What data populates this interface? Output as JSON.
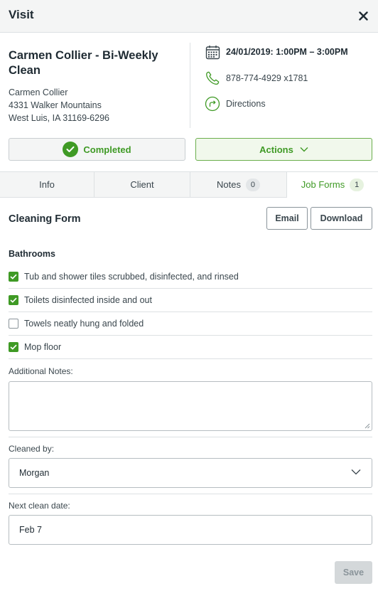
{
  "header": {
    "title": "Visit",
    "close_icon": "close-icon"
  },
  "client": {
    "title": "Carmen Collier - Bi-Weekly Clean",
    "name": "Carmen Collier",
    "street": "4331 Walker Mountains",
    "city": "West Luis, IA 31169-6296"
  },
  "details": {
    "date": "24/01/2019: 1:00PM – 3:00PM",
    "phone": "878-774-4929 x1781",
    "directions": "Directions",
    "date_icon": "calendar-icon",
    "phone_icon": "phone-icon",
    "directions_icon": "directions-icon"
  },
  "status": {
    "label": "Completed",
    "color": "#3f9a25"
  },
  "actions": {
    "label": "Actions"
  },
  "tabs": [
    {
      "label": "Info"
    },
    {
      "label": "Client"
    },
    {
      "label": "Notes",
      "badge": "0"
    },
    {
      "label": "Job Forms",
      "badge": "1",
      "active": true
    }
  ],
  "form": {
    "title": "Cleaning Form",
    "email_label": "Email",
    "download_label": "Download",
    "section": "Bathrooms",
    "items": [
      {
        "label": "Tub and shower tiles scrubbed, disinfected, and rinsed",
        "checked": true
      },
      {
        "label": "Toilets disinfected inside and out",
        "checked": true
      },
      {
        "label": "Towels neatly hung and folded",
        "checked": false
      },
      {
        "label": "Mop floor",
        "checked": true
      }
    ],
    "notes_label": "Additional Notes:",
    "notes_value": "",
    "cleaned_by_label": "Cleaned by:",
    "cleaned_by_value": "Morgan",
    "next_date_label": "Next clean date:",
    "next_date_value": "Feb 7",
    "save_label": "Save"
  },
  "colors": {
    "accent": "#3f9a25",
    "border": "#dde1e3",
    "header_bg": "#f4f5f5"
  }
}
